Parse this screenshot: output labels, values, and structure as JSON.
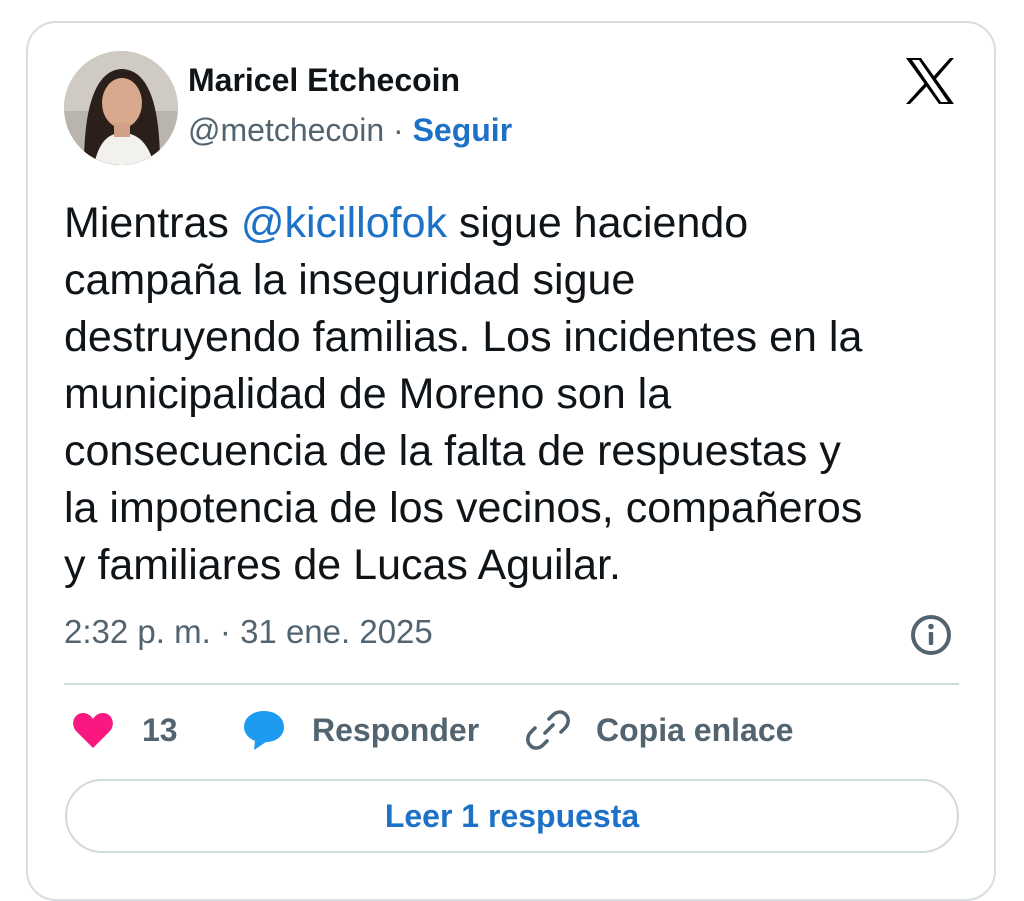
{
  "author": {
    "name": "Maricel Etchecoin",
    "handle": "@metchecoin",
    "separator": "·",
    "follow_label": "Seguir"
  },
  "tweet": {
    "lines": [
      {
        "before": "Mientras ",
        "mention": "@kicillofok",
        "after": " sigue haciendo"
      },
      "campaña la inseguridad sigue",
      "destruyendo familias. Los incidentes en la",
      "municipalidad de Moreno son la",
      "consecuencia de la falta de respuestas y",
      "la impotencia de los vecinos, compañeros",
      "y familiares de Lucas Aguilar."
    ],
    "timestamp": "2:32 p. m. · 31 ene. 2025"
  },
  "actions": {
    "like_count": "13",
    "reply_label": "Responder",
    "copy_label": "Copia enlace"
  },
  "read_replies_label": "Leer 1 respuesta",
  "icons": [
    "x-logo-icon",
    "info-icon",
    "heart-icon",
    "reply-bubble-icon",
    "link-icon"
  ],
  "colors": {
    "accent": "#1d72c8",
    "heart": "#f91880",
    "reply_bubble": "#1d9bf0",
    "text": "#0f1419",
    "muted": "#536471"
  }
}
